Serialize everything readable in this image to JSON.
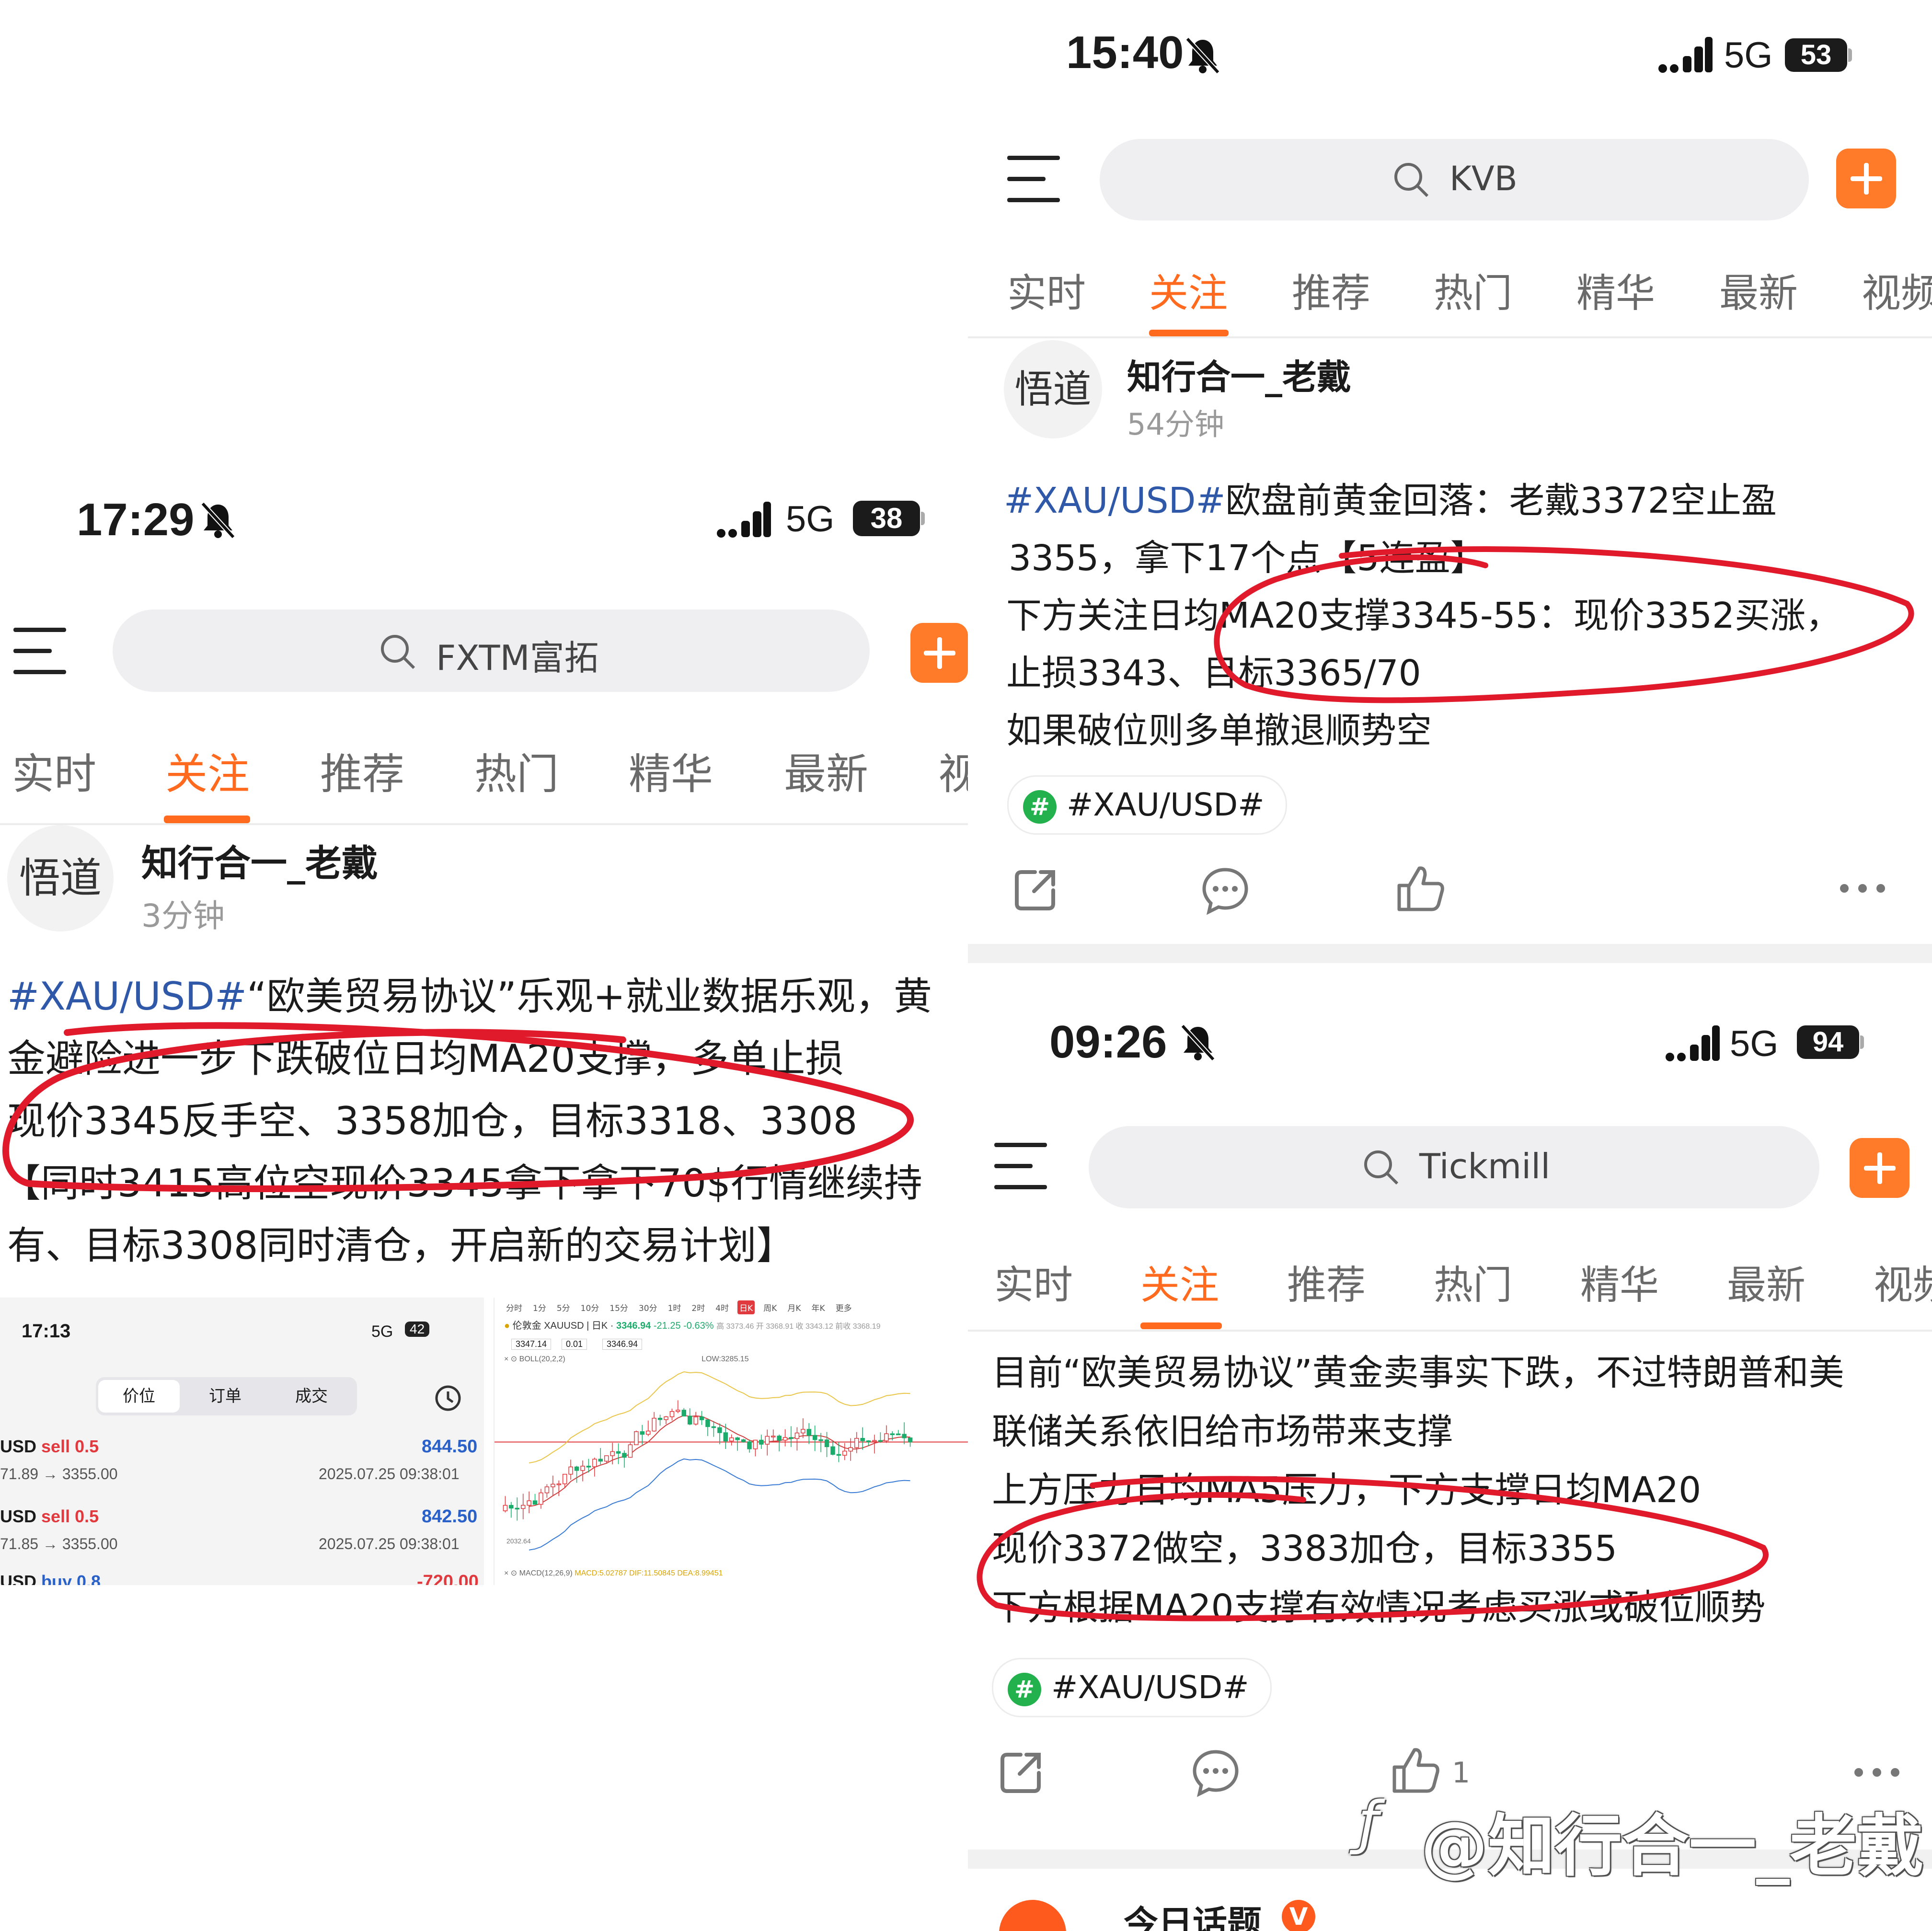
{
  "left": {
    "status": {
      "time": "17:29",
      "network": "5G",
      "battery": "38"
    },
    "search": {
      "placeholder": "FXTM富拓"
    },
    "tabs": [
      "实时",
      "关注",
      "推荐",
      "热门",
      "精华",
      "最新",
      "视"
    ],
    "post": {
      "author": "知行合一_老戴",
      "time": "3分钟",
      "avatar_text": "悟道",
      "lines": [
        {
          "hashtag": "#XAU/USD#",
          "text": "“欧美贸易协议”乐观+就业数据乐观，黄"
        },
        {
          "hashtag": "",
          "text": "金避险进一步下跌破位日均MA20支撑，多单止损"
        },
        {
          "hashtag": "",
          "text": "现价3345反手空、3358加仓，目标3318、3308"
        },
        {
          "hashtag": "",
          "text": "【同时3415高位空现价3345拿下拿下70$行情继续持"
        },
        {
          "hashtag": "",
          "text": "有、目标3308同时清仓，开启新的交易计划】"
        }
      ]
    },
    "screenshot_left": {
      "time": "17:13",
      "network": "5G",
      "battery": "42",
      "tabs": [
        "价位",
        "订单",
        "成交"
      ],
      "orders": [
        {
          "symbol": "USD",
          "side": "sell 0.5",
          "price_path": "71.89 → 3355.00",
          "amount": "844.50",
          "timestamp": "2025.07.25 09:38:01"
        },
        {
          "symbol": "USD",
          "side": "sell 0.5",
          "price_path": "71.85 → 3355.00",
          "amount": "842.50",
          "timestamp": "2025.07.25 09:38:01"
        },
        {
          "symbol": "USD",
          "side": "buy 0.8",
          "price_path": "",
          "amount": "-720.00",
          "timestamp": ""
        }
      ]
    },
    "screenshot_chart": {
      "timeframes": [
        "分时",
        "1分",
        "5分",
        "10分",
        "15分",
        "30分",
        "1时",
        "2时",
        "4时",
        "日K",
        "周K",
        "月K",
        "年K",
        "更多"
      ],
      "symbol": "伦敦金 XAUUSD",
      "period": "日K",
      "price": "3346.94",
      "change": "-21.25",
      "change_pct": "-0.63%",
      "ohlc_text": "高 3373.46 开 3368.91 收 3343.12 前收 3368.19",
      "inputs": [
        "3347.14",
        "0.01",
        "3346.94"
      ],
      "boll_label": "BOLL(20,2,2)",
      "low_label": "LOW:3285.15",
      "low_value": "2032.64",
      "macd_label": "MACD(12,26,9)",
      "macd_value": "MACD:5.02787",
      "dif_value": "DIF:11.50845",
      "dea_value": "DEA:8.99451",
      "colors": {
        "up": "#e0393e",
        "down": "#1bab6a",
        "upper_band": "#e9c64a",
        "mid_band": "#d04040",
        "lower_band": "#3a7bd5"
      }
    }
  },
  "top_right": {
    "status": {
      "time": "15:40",
      "network": "5G",
      "battery": "53"
    },
    "search": {
      "placeholder": "KVB"
    },
    "tabs": [
      "实时",
      "关注",
      "推荐",
      "热门",
      "精华",
      "最新",
      "视频"
    ],
    "post": {
      "author": "知行合一_老戴",
      "time": "54分钟",
      "avatar_text": "悟道",
      "lines": [
        {
          "hashtag": "#XAU/USD#",
          "text": "欧盘前黄金回落：老戴3372空止盈"
        },
        {
          "hashtag": "",
          "text": "3355，拿下17个点【5连盈】"
        },
        {
          "hashtag": "",
          "text": "下方关注日均MA20支撑3345-55：现价3352买涨，"
        },
        {
          "hashtag": "",
          "text": "止损3343、目标3365/70"
        },
        {
          "hashtag": "",
          "text": "如果破位则多单撤退顺势空"
        }
      ],
      "topic": "#XAU/USD#"
    }
  },
  "bottom_right": {
    "status": {
      "time": "09:26",
      "network": "5G",
      "battery": "94"
    },
    "search": {
      "placeholder": "Tickmill"
    },
    "tabs": [
      "实时",
      "关注",
      "推荐",
      "热门",
      "精华",
      "最新",
      "视频"
    ],
    "post": {
      "lines": [
        {
          "hashtag": "",
          "text": "目前“欧美贸易协议”黄金卖事实下跌，不过特朗普和美"
        },
        {
          "hashtag": "",
          "text": "联储关系依旧给市场带来支撑"
        },
        {
          "hashtag": "",
          "text": "上方压力日均MA5压力，下方支撑日均MA20"
        },
        {
          "hashtag": "",
          "text": "现价3372做空，3383加仓，目标3355"
        },
        {
          "hashtag": "",
          "text": "下方根据MA20支撑有效情况考虑买涨或破位顺势"
        }
      ],
      "topic": "#XAU/USD#",
      "like_count": "1"
    },
    "next_item": {
      "title": "今日话题",
      "badge": "V"
    }
  },
  "watermark": "@知行合一_老戴",
  "colors": {
    "accent": "#ff6a1e",
    "hashtag": "#2f59a8",
    "annotation": "#e0192b",
    "topic_icon": "#22b14c"
  }
}
